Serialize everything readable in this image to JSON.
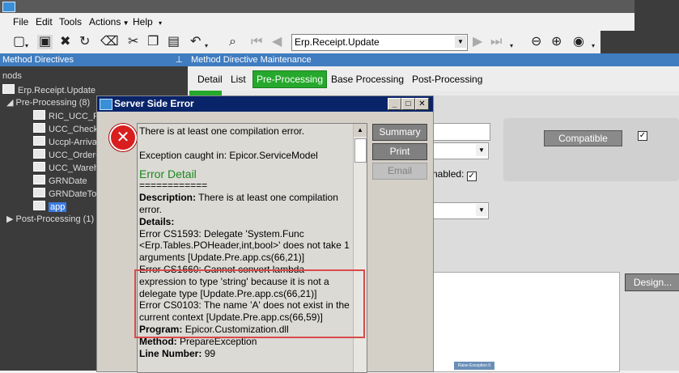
{
  "menu": {
    "items": [
      "File",
      "Edit",
      "Tools",
      "Actions",
      "Help"
    ]
  },
  "toolbar": {
    "combo_value": "Erp.Receipt.Update"
  },
  "left_panel": {
    "title": "Method Directives",
    "pin": "ᵖ",
    "tree": {
      "root_partial": "nods",
      "method": "Erp.Receipt.Update",
      "pre_group": "Pre-Processing (8)",
      "pre_items": [
        "RIC_UCC_Re",
        "UCC_Check",
        "Uccpl-Arriva",
        "UCC_OrderC",
        "UCC_Wareh",
        "GRNDate",
        "GRNDateToo",
        "app"
      ],
      "post_group": "Post-Processing (1)"
    }
  },
  "right_panel": {
    "title": "Method Directive Maintenance",
    "tabs": [
      "Detail",
      "List",
      "Pre-Processing",
      "Base Processing",
      "Post-Processing"
    ],
    "compatible_label": "Compatible",
    "enabled_label": "nabled:",
    "design_label": "Design...",
    "canvas_mini": "Raise Exception 0"
  },
  "dialog": {
    "title": "Server Side Error",
    "buttons": {
      "summary": "Summary",
      "print": "Print",
      "email": "Email"
    },
    "message": {
      "line1": "There is at least one compilation error.",
      "line2": "Exception caught in: Epicor.ServiceModel",
      "section_title": "Error Detail",
      "rule": "============",
      "desc_label": "Description:",
      "desc_text": "There is at least one compilation error.",
      "details_label": "Details:",
      "details": [
        "Error CS1593: Delegate 'System.Func <Erp.Tables.POHeader,int,bool>' does not take 1 arguments [Update.Pre.app.cs(66,21)]",
        "Error CS1660: Cannot convert lambda expression to type 'string' because it is not a delegate type [Update.Pre.app.cs(66,21)]",
        "Error CS0103: The name 'A' does not exist in the current context [Update.Pre.app.cs(66,59)]"
      ],
      "program_label": "Program:",
      "program_value": "Epicor.Customization.dll",
      "method_label": "Method:",
      "method_value": "PrepareException",
      "line_label": "Line Number:",
      "line_value": "99"
    }
  }
}
